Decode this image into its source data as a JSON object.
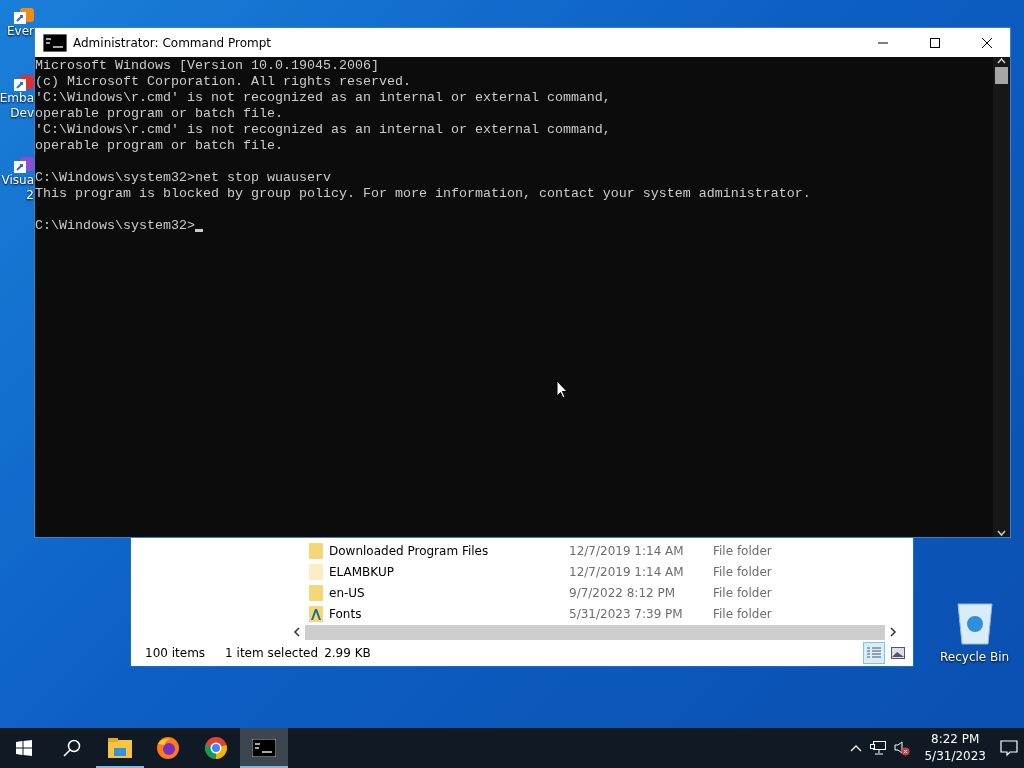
{
  "desktop_icons": [
    {
      "lines": [
        "Ever"
      ],
      "kind": "shortcut-orange"
    },
    {
      "lines": [
        "Emba",
        "Dev"
      ],
      "kind": "shortcut-red"
    },
    {
      "lines": [
        "Visua",
        "2"
      ],
      "kind": "shortcut-purple"
    }
  ],
  "recycle_bin": {
    "label": "Recycle Bin"
  },
  "explorer": {
    "rows": [
      {
        "name": "Downloaded Program Files",
        "date": "12/7/2019 1:14 AM",
        "type": "File folder",
        "kind": "folder"
      },
      {
        "name": "ELAMBKUP",
        "date": "12/7/2019 1:14 AM",
        "type": "File folder",
        "kind": "folder-pale"
      },
      {
        "name": "en-US",
        "date": "9/7/2022 8:12 PM",
        "type": "File folder",
        "kind": "folder"
      },
      {
        "name": "Fonts",
        "date": "5/31/2023 7:39 PM",
        "type": "File folder",
        "kind": "fonts"
      }
    ],
    "status_bar": {
      "items": "100 items",
      "selection": "1 item selected",
      "size": "2.99 KB"
    },
    "views": [
      {
        "kind": "details",
        "selected": true
      },
      {
        "kind": "preview",
        "selected": false
      }
    ]
  },
  "console": {
    "title": "Administrator: Command Prompt",
    "blocks": [
      [
        "Microsoft Windows [Version 10.0.19045.2006]",
        "(c) Microsoft Corporation. All rights reserved.",
        "'C:\\Windows\\r.cmd' is not recognized as an internal or external command,",
        "operable program or batch file.",
        "'C:\\Windows\\r.cmd' is not recognized as an internal or external command,",
        "operable program or batch file."
      ],
      [
        "C:\\Windows\\system32>net stop wuauserv",
        "This program is blocked by group policy. For more information, contact your system administrator."
      ],
      [
        "C:\\Windows\\system32>"
      ]
    ]
  },
  "taskbar": {
    "apps": [
      {
        "kind": "explorer",
        "running": true,
        "selected": false
      },
      {
        "kind": "firefox",
        "running": false,
        "selected": false
      },
      {
        "kind": "chrome",
        "running": false,
        "selected": false
      },
      {
        "kind": "console",
        "running": true,
        "selected": true
      }
    ],
    "time": "8:22 PM",
    "date": "5/31/2023"
  }
}
